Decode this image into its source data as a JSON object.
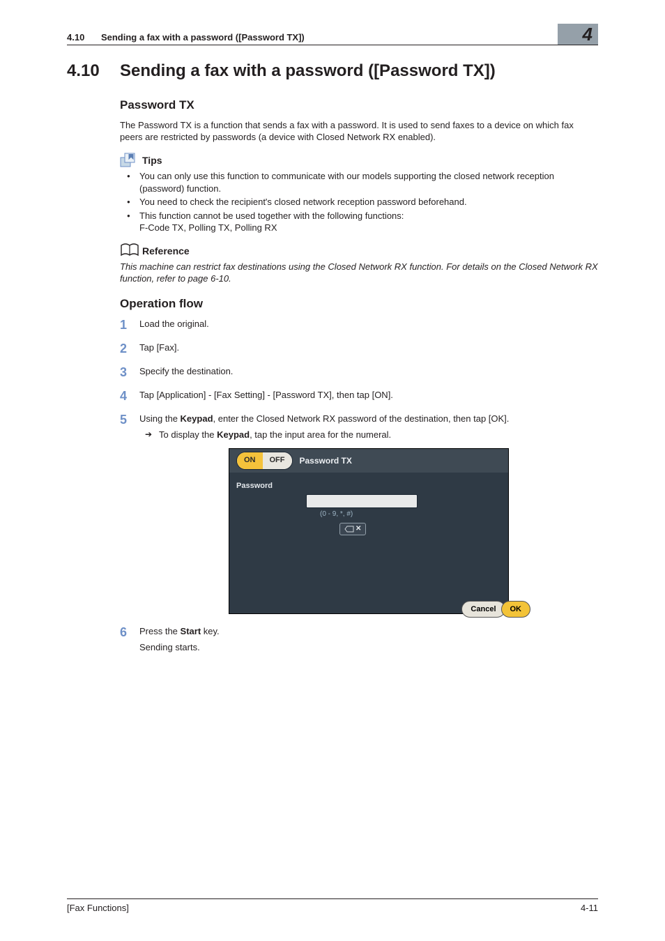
{
  "header": {
    "section_number": "4.10",
    "running_title": "Sending a fax with a password ([Password TX])",
    "chapter_tab": "4"
  },
  "h1": {
    "number": "4.10",
    "title": "Sending a fax with a password ([Password TX])"
  },
  "section1": {
    "heading": "Password TX",
    "intro": "The Password TX is a function that sends a fax with a password. It is used to send faxes to a device on which fax peers are restricted by passwords (a device with Closed Network RX enabled)."
  },
  "tips": {
    "heading": "Tips",
    "items": [
      "You can only use this function to communicate with our models supporting the closed network reception (password) function.",
      "You need to check the recipient's closed network reception password beforehand.",
      "This function cannot be used together with the following functions:\nF-Code TX, Polling TX, Polling RX"
    ]
  },
  "reference": {
    "heading": "Reference",
    "body": "This machine can restrict fax destinations using the Closed Network RX function. For details on the Closed Network RX function, refer to page 6-10."
  },
  "section2": {
    "heading": "Operation flow",
    "steps": [
      {
        "text": "Load the original."
      },
      {
        "text": "Tap [Fax]."
      },
      {
        "text": "Specify the destination."
      },
      {
        "text": "Tap [Application] - [Fax Setting] - [Password TX], then tap [ON]."
      },
      {
        "text_pre": "Using the ",
        "text_bold1": "Keypad",
        "text_post": ", enter the Closed Network RX password of the destination, then tap [OK].",
        "sub_pre": "To display the ",
        "sub_bold": "Keypad",
        "sub_post": ", tap the input area for the numeral."
      },
      {
        "text_pre": "Press the ",
        "text_bold1": "Start",
        "text_post": " key.",
        "tail": "Sending starts."
      }
    ]
  },
  "ui": {
    "toggle_on": "ON",
    "toggle_off": "OFF",
    "title": "Password TX",
    "password_label": "Password",
    "password_value": "",
    "hint": "(0 - 9, *, #)",
    "cancel": "Cancel",
    "ok": "OK"
  },
  "footer": {
    "left": "[Fax Functions]",
    "right": "4-11"
  }
}
